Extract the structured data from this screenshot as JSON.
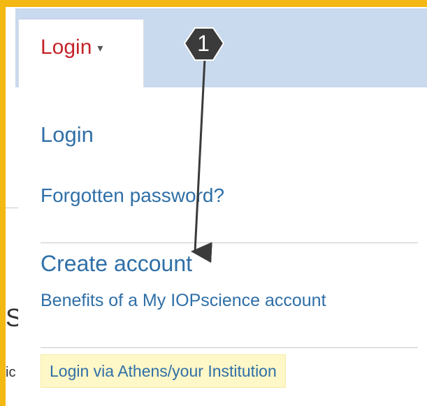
{
  "login_menu": {
    "toggle_label": "Login",
    "items": {
      "login": "Login",
      "forgotten_password": "Forgotten password?",
      "create_account": "Create account",
      "benefits": "Benefits of a My IOPscience account",
      "athens_login": "Login via Athens/your Institution"
    }
  },
  "background_fragments": {
    "letter_s": "S",
    "letter_c": "ic"
  },
  "callout": {
    "number": "1",
    "color": "#3b3b3b"
  },
  "colors": {
    "border_accent": "#f3b811",
    "nav_bar": "#c9d9ee",
    "link": "#2f6fa7",
    "login_toggle": "#c4242b",
    "athens_highlight": "#fef7c7"
  }
}
